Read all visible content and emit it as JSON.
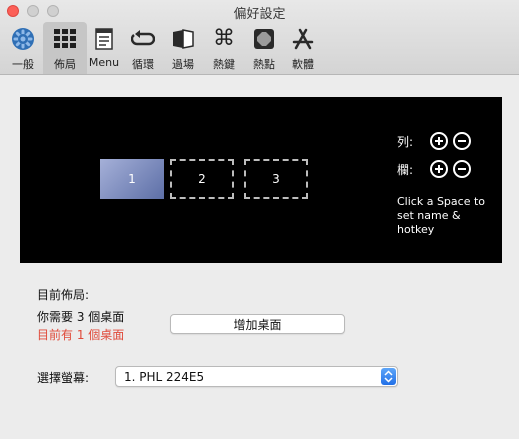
{
  "window": {
    "title": "偏好設定"
  },
  "toolbar": {
    "items": [
      {
        "label": "一般",
        "icon": "gear-icon"
      },
      {
        "label": "佈局",
        "icon": "grid-layout-icon",
        "selected": true
      },
      {
        "label": "Menu",
        "icon": "menu-icon"
      },
      {
        "label": "循環",
        "icon": "cycle-icon"
      },
      {
        "label": "過場",
        "icon": "transition-icon"
      },
      {
        "label": "熱鍵",
        "icon": "command-key-icon"
      },
      {
        "label": "熱點",
        "icon": "hot-corner-icon"
      },
      {
        "label": "軟體",
        "icon": "app-store-icon"
      }
    ]
  },
  "preview": {
    "spaces": [
      "1",
      "2",
      "3"
    ],
    "rows_label": "列:",
    "columns_label": "欄:",
    "hint": "Click a Space to set name & hotkey"
  },
  "layout_section": {
    "heading": "目前佈局:",
    "required_text": "你需要 3 個桌面",
    "current_text": "目前有 1 個桌面",
    "add_button": "增加桌面"
  },
  "screen": {
    "label": "選擇螢幕:",
    "selected": "1. PHL 224E5"
  },
  "colors": {
    "accent": "#2270e8",
    "warning_text": "#e04a3a",
    "preview_background": "#000000"
  }
}
